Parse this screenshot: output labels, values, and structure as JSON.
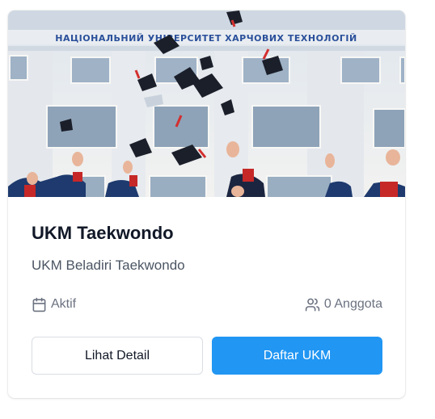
{
  "card": {
    "image": {
      "alt": "",
      "facade_sign": "НАЦІОНАЛЬНИЙ УНІВЕРСИТЕТ ХАРЧОВИХ ТЕХНОЛОГІЙ"
    },
    "title": "UKM Taekwondo",
    "subtitle": "UKM Beladiri Taekwondo",
    "status": {
      "icon": "calendar-icon",
      "label": "Aktif"
    },
    "members": {
      "icon": "users-icon",
      "label": "0 Anggota"
    },
    "actions": {
      "detail_label": "Lihat Detail",
      "join_label": "Daftar UKM"
    }
  },
  "colors": {
    "primary": "#2196f3",
    "title": "#111827",
    "muted": "#6b7280",
    "border": "#d9dde3"
  }
}
